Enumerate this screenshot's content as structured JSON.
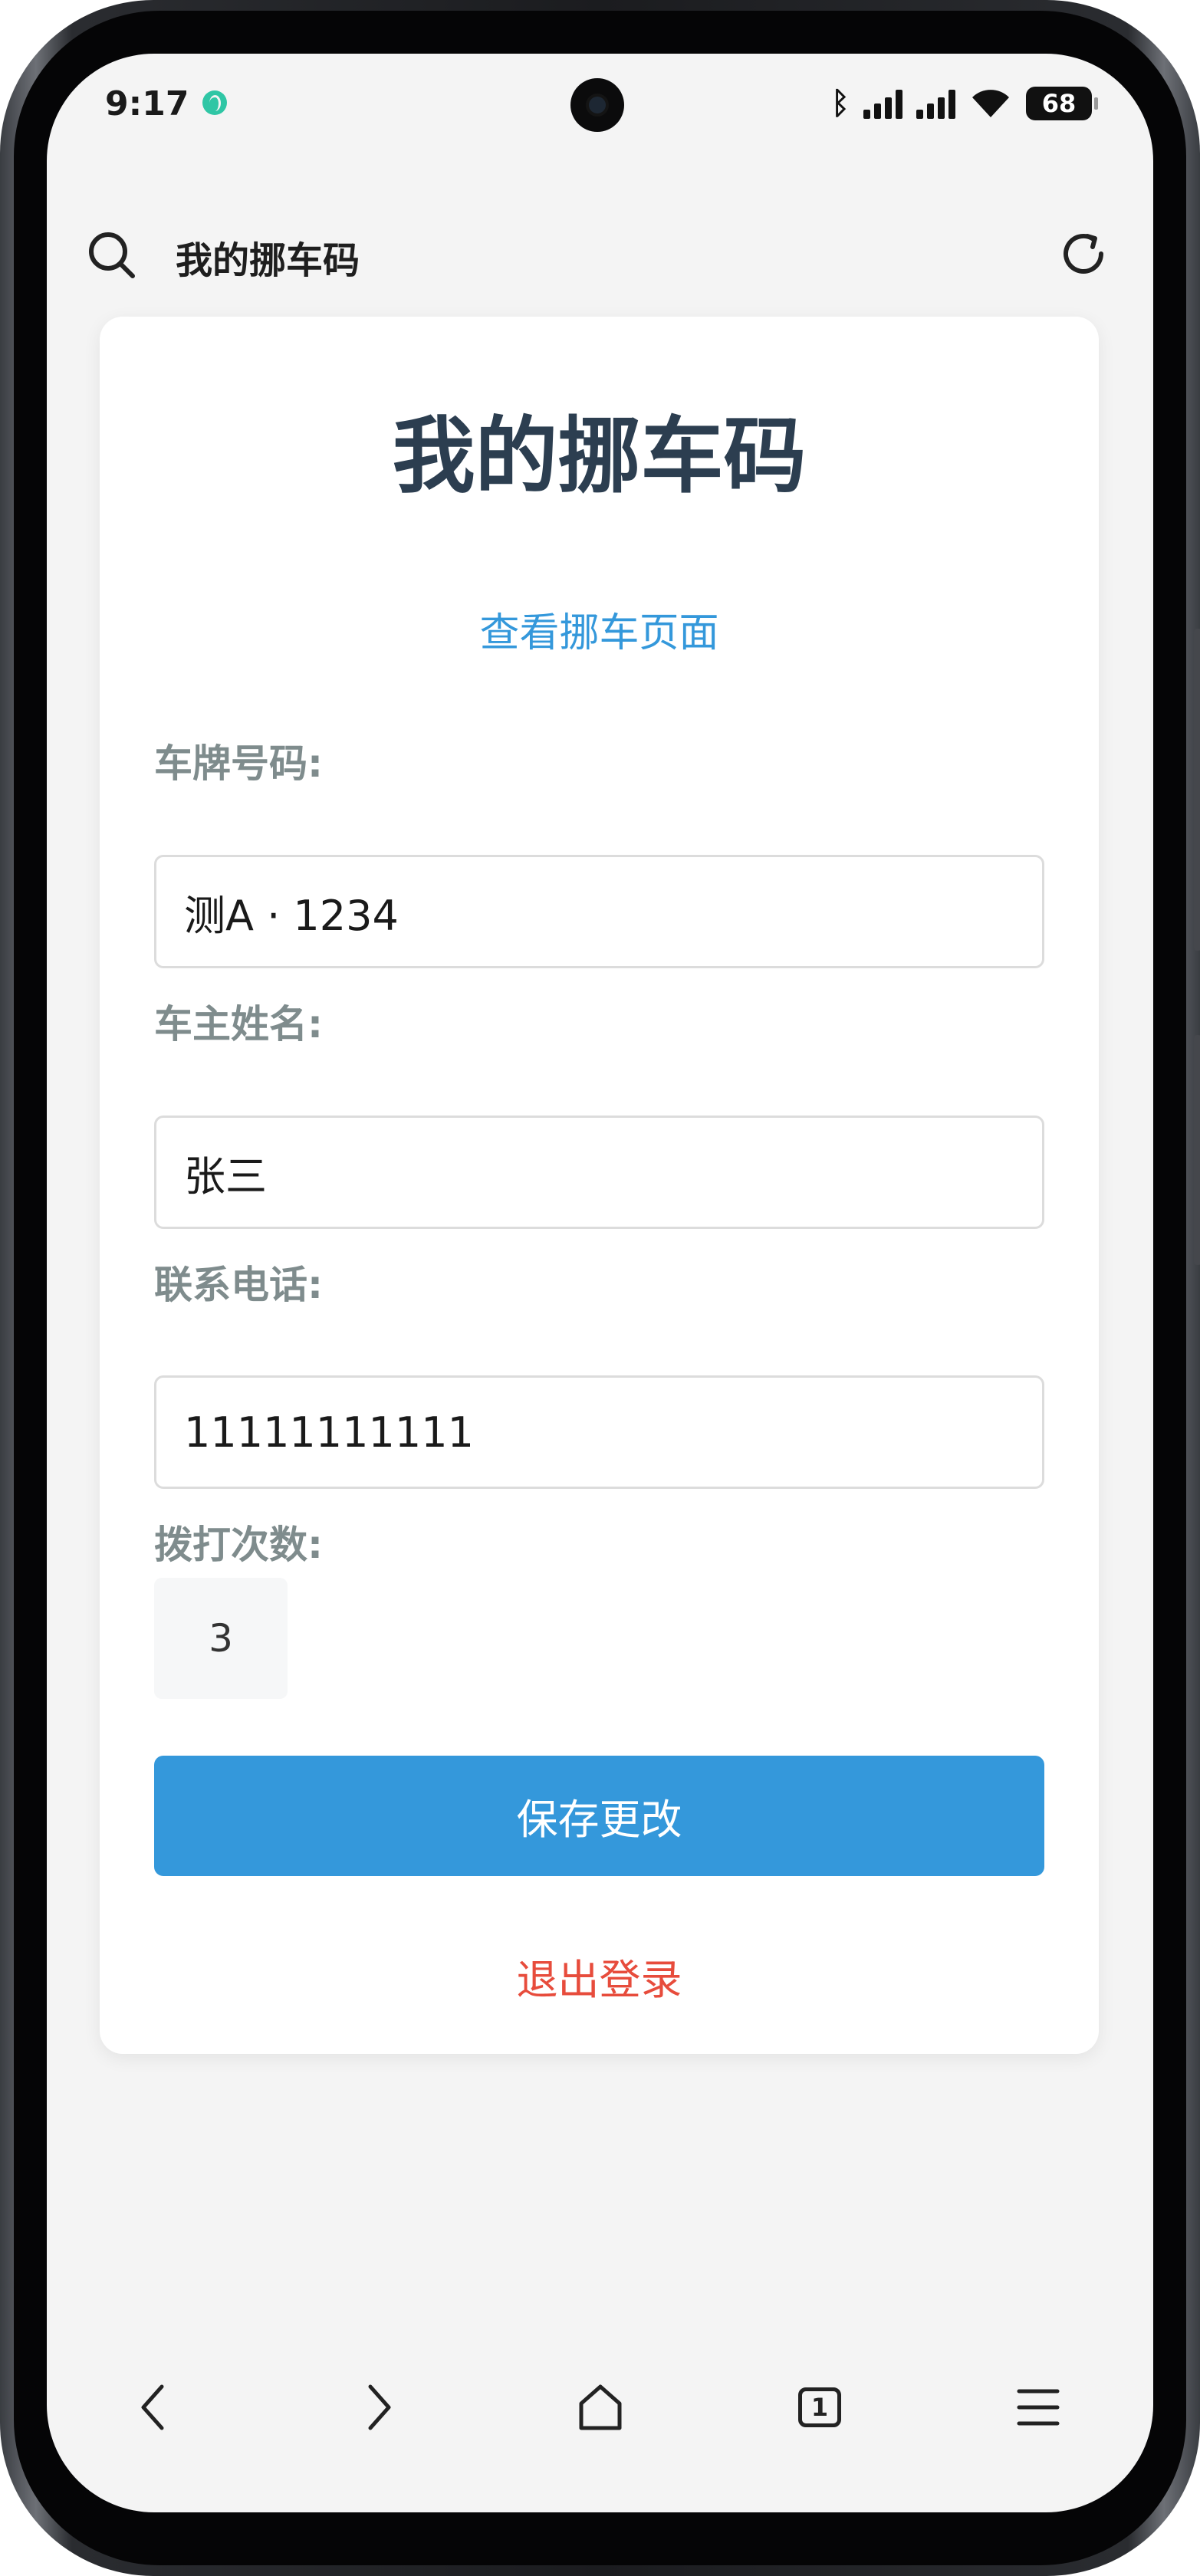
{
  "status_bar": {
    "time": "9:17",
    "battery": "68",
    "icons": [
      "globe-icon",
      "bluetooth-icon",
      "signal-icon",
      "signal-icon",
      "wifi-icon",
      "battery-icon"
    ]
  },
  "browser": {
    "title": "我的挪车码",
    "icons": [
      "search-icon",
      "reload-icon"
    ]
  },
  "card": {
    "title": "我的挪车码",
    "view_link": "查看挪车页面",
    "plate_label": "车牌号码:",
    "plate_value": "测A · 1234",
    "owner_label": "车主姓名:",
    "owner_value": "张三",
    "phone_label": "联系电话:",
    "phone_value": "11111111111",
    "calls_label": "拨打次数:",
    "calls_value": "3",
    "save_label": "保存更改",
    "logout_label": "退出登录"
  },
  "bottom_nav": {
    "tab_count": "1",
    "icons": [
      "back-icon",
      "forward-icon",
      "home-icon",
      "tabs-icon",
      "menu-icon"
    ]
  },
  "colors": {
    "accent": "#3498db",
    "danger": "#e74c3c",
    "title": "#2c3e50",
    "label": "#7f8c8d",
    "background": "#f4f4f4"
  }
}
